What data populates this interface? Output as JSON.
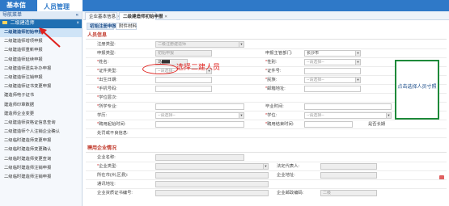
{
  "topbar": {
    "tab1": "基本信息",
    "tab2": "人员管理"
  },
  "sidebar": {
    "header": "导航菜单",
    "collapse_glyph": "«",
    "group": "二级建造师",
    "group_close": "×",
    "items": [
      "二级建造师初始申报",
      "二级建造师增项申报",
      "二级建造师重新申报",
      "二级建造师延续申报",
      "二级建造师遗失补办申报",
      "二级建造师注销申报",
      "二级建造师证书变更申报",
      "建造师电子证书",
      "建造师印章数据",
      "建造师企业变更",
      "二级建造师资格证信息查询",
      "二级建造师个人注销企业确认",
      "二级临时建造师变更申报",
      "二级临时建造师变更确认",
      "二级临时建造师变更查询",
      "二级临时建造师注销申报",
      "二级临时建造师注销申报"
    ]
  },
  "page_tabs": [
    {
      "label": "企业基本信息",
      "close": "×"
    },
    {
      "label": "二级建造师初始申报",
      "close": "×"
    }
  ],
  "subtabs": [
    "初始注册申报",
    "附件材料"
  ],
  "section1": "人员信息",
  "section2": "聘用企业情况",
  "form": {
    "reg_type_label": "注册类型:",
    "reg_type_value": "二级注册建造师",
    "apply_type_label": "申报类型:",
    "apply_type_value": "初始申报",
    "dept_label": "申报主管部门:",
    "dept_value": "长沙市",
    "name_label": "姓名:",
    "name_value": "马▇▇",
    "gender_label": "性别:",
    "gender_placeholder": "--请选择--",
    "idtype_label": "证件类型:",
    "idtype_placeholder": "--请选择--",
    "idno_label": "证件号:",
    "birth_label": "出生日期:",
    "nation_label": "民族:",
    "nation_placeholder": "--请选择--",
    "mobile_label": "手机号码:",
    "email_label": "邮箱地址:",
    "edu_label": "学位层次:",
    "major_label": "所学专业:",
    "graduation_label": "毕业时间:",
    "degree_label": "学历:",
    "degree_placeholder": "--请选择--",
    "xuewei_label": "学位:",
    "xuewei_placeholder": "--请选择--",
    "hire_start_label": "聘用起始时间:",
    "hire_end_label": "聘用结束时间:",
    "long_term": "是否长期",
    "extra_label": "处罚或不良信息:",
    "company_label": "企业名称:",
    "company_type_label": "企业类型:",
    "legal_label": "法定代表人:",
    "region_label": "所在市(州,区县):",
    "address_label": "企业地址:",
    "phone_label": "通讯地址:",
    "license_label": "企业资质证书编号:",
    "postal_label": "企业邮政编码:",
    "postal_value": "二级"
  },
  "photo_box": "点击选择人员寸照",
  "annotation": "选择二建人员"
}
